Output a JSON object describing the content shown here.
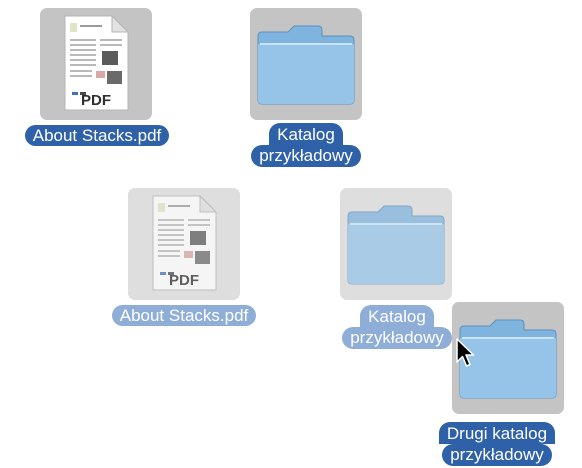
{
  "items": [
    {
      "name": "About Stacks.pdf",
      "type": "pdf",
      "state": "selected",
      "badge": "PDF"
    },
    {
      "name_lines": [
        "Katalog",
        "przykładowy"
      ],
      "type": "folder",
      "state": "selected"
    },
    {
      "name": "About Stacks.pdf",
      "type": "pdf",
      "state": "drag-ghost",
      "badge": "PDF"
    },
    {
      "name_lines": [
        "Katalog",
        "przykładowy"
      ],
      "type": "folder",
      "state": "drag-ghost"
    },
    {
      "name_lines": [
        "Drugi katalog",
        "przykładowy"
      ],
      "type": "folder",
      "state": "selected"
    }
  ],
  "colors": {
    "selection": "#2f61a8",
    "selection_faded": "#8eaed8",
    "tile": "#c4c4c4",
    "folder": "#7fb4de"
  },
  "cursor": {
    "icon": "arrow-pointer-icon"
  }
}
